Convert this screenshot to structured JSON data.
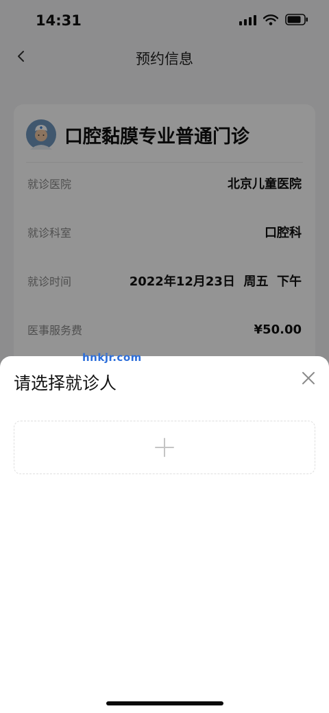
{
  "status_bar": {
    "time": "14:31"
  },
  "nav": {
    "title": "预约信息"
  },
  "card": {
    "clinic_name": "口腔黏膜专业普通门诊",
    "rows": [
      {
        "label": "就诊医院",
        "value": "北京儿童医院"
      },
      {
        "label": "就诊科室",
        "value": "口腔科"
      },
      {
        "label": "就诊时间",
        "value": "2022年12月23日  周五  下午"
      },
      {
        "label": "医事服务费",
        "value": "¥50.00"
      }
    ]
  },
  "sheet": {
    "title": "请选择就诊人"
  },
  "watermark": "hnkjr.com",
  "colors": {
    "overlay": "#000000",
    "sheet_bg": "#ffffff",
    "watermark": "#2d6ed9"
  }
}
